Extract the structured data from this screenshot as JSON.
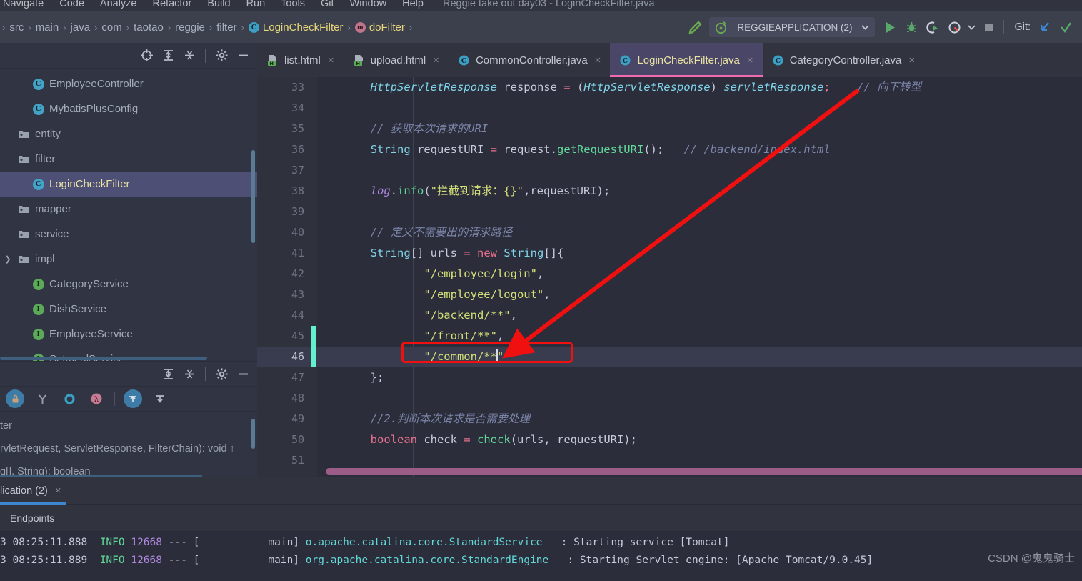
{
  "window": {
    "title": "Reggie take out day03 - LoginCheckFilter.java",
    "menu": [
      "Navigate",
      "Code",
      "Analyze",
      "Refactor",
      "Build",
      "Run",
      "Tools",
      "Git",
      "Window",
      "Help"
    ]
  },
  "breadcrumb": {
    "items": [
      "src",
      "main",
      "java",
      "com",
      "taotao",
      "reggie",
      "filter"
    ],
    "class_name": "LoginCheckFilter",
    "class_badge": "C",
    "method_name": "doFilter",
    "method_badge": "m",
    "separator": "›"
  },
  "toolbar": {
    "build_icon": "hammer-icon",
    "run_config": "REGGIEAPPLICATION (2)",
    "run_config_icon": "spring-boot-icon",
    "dropdown_icon": "chevron-down-icon",
    "run_icon": "run-icon",
    "debug_icon": "debug-icon",
    "run_coverage_icon": "run-with-coverage-icon",
    "profiler_icon": "profiler-icon",
    "profiler_dropdown_icon": "chevron-down-icon",
    "stop_icon": "stop-icon",
    "git_label": "Git:",
    "git_update_icon": "git-update-project-icon",
    "git_commit_icon": "git-commit-icon",
    "accent_run": "#59a869",
    "accent_active_tab": "#4a4668",
    "accent_tab_underline": "#f06ab0"
  },
  "sidebar": {
    "toolbar_icons": [
      "select-opened-file-icon",
      "expand-all-icon",
      "collapse-all-icon",
      "settings-gear-icon",
      "hide-panel-icon"
    ],
    "items": [
      {
        "label": "EmployeeController",
        "icon": "class-icon",
        "kind": "class",
        "indent": 1,
        "arrow": false,
        "selected": false
      },
      {
        "label": "MybatisPlusConfig",
        "icon": "class-icon",
        "kind": "class",
        "indent": 1,
        "arrow": false,
        "selected": false
      },
      {
        "label": "entity",
        "icon": "folder-icon",
        "kind": "folder",
        "indent": 0,
        "arrow": false,
        "selected": false
      },
      {
        "label": "filter",
        "icon": "folder-icon",
        "kind": "folder",
        "indent": 0,
        "arrow": false,
        "selected": false
      },
      {
        "label": "LoginCheckFilter",
        "icon": "class-icon",
        "kind": "class",
        "indent": 1,
        "arrow": false,
        "selected": true
      },
      {
        "label": "mapper",
        "icon": "folder-icon",
        "kind": "folder",
        "indent": 0,
        "arrow": false,
        "selected": false
      },
      {
        "label": "service",
        "icon": "folder-icon",
        "kind": "folder",
        "indent": 0,
        "arrow": false,
        "selected": false
      },
      {
        "label": "impl",
        "icon": "folder-icon",
        "kind": "folder",
        "indent": 0,
        "arrow": true,
        "selected": false
      },
      {
        "label": "CategoryService",
        "icon": "interface-icon",
        "kind": "interface",
        "indent": 1,
        "arrow": false,
        "selected": false
      },
      {
        "label": "DishService",
        "icon": "interface-icon",
        "kind": "interface",
        "indent": 1,
        "arrow": false,
        "selected": false
      },
      {
        "label": "EmployeeService",
        "icon": "interface-icon",
        "kind": "interface",
        "indent": 1,
        "arrow": false,
        "selected": false
      },
      {
        "label": "SetmealService",
        "icon": "interface-icon",
        "kind": "interface",
        "indent": 1,
        "arrow": false,
        "selected": false
      }
    ]
  },
  "structure": {
    "toolbar_icons": [
      "expand-all-icon",
      "collapse-all-icon",
      "settings-gear-icon",
      "hide-panel-icon"
    ],
    "filter_icons": [
      "show-non-public-icon",
      "show-inherited-icon",
      "show-fields-icon",
      "show-properties-icon",
      "sort-by-visibility-icon",
      "sort-alphabetically-icon"
    ],
    "rows": [
      {
        "text": "ter"
      },
      {
        "text": "rvletRequest, ServletResponse, FilterChain): void ↑"
      },
      {
        "text": "g[], String): boolean"
      }
    ]
  },
  "editor_tabs": [
    {
      "label": "list.html",
      "icon": "html-file-icon",
      "active": false,
      "close": "×"
    },
    {
      "label": "upload.html",
      "icon": "html-file-icon",
      "active": false,
      "close": "×"
    },
    {
      "label": "CommonController.java",
      "icon": "java-class-icon",
      "active": false,
      "close": "×"
    },
    {
      "label": "LoginCheckFilter.java",
      "icon": "java-class-icon",
      "active": true,
      "close": "×"
    },
    {
      "label": "CategoryController.java",
      "icon": "java-class-icon",
      "active": false,
      "close": "×"
    }
  ],
  "editor": {
    "first_line": 33,
    "current_line": 46,
    "changed_lines": [
      45,
      46
    ],
    "lines": [
      {
        "n": 33,
        "tokens": [
          {
            "t": "        ",
            "c": "pun"
          },
          {
            "t": "HttpServletResponse",
            "c": "typi"
          },
          {
            "t": " response ",
            "c": "var"
          },
          {
            "t": "=",
            "c": "op"
          },
          {
            "t": " (",
            "c": "pun"
          },
          {
            "t": "HttpServletResponse",
            "c": "typi"
          },
          {
            "t": ") ",
            "c": "pun"
          },
          {
            "t": "servletResponse",
            "c": "typi"
          },
          {
            "t": ";",
            "c": "op"
          },
          {
            "t": "    ",
            "c": "pun"
          },
          {
            "t": "// 向下转型",
            "c": "cmt"
          }
        ]
      },
      {
        "n": 34,
        "tokens": []
      },
      {
        "n": 35,
        "tokens": [
          {
            "t": "        ",
            "c": "pun"
          },
          {
            "t": "// 获取本次请求的URI",
            "c": "cmt"
          }
        ]
      },
      {
        "n": 36,
        "tokens": [
          {
            "t": "        ",
            "c": "pun"
          },
          {
            "t": "String",
            "c": "typ"
          },
          {
            "t": " requestURI ",
            "c": "var"
          },
          {
            "t": "=",
            "c": "op"
          },
          {
            "t": " request.",
            "c": "var"
          },
          {
            "t": "getRequestURI",
            "c": "mth"
          },
          {
            "t": "();",
            "c": "pun"
          },
          {
            "t": "   ",
            "c": "pun"
          },
          {
            "t": "// /backend/index.html",
            "c": "cmt"
          }
        ]
      },
      {
        "n": 37,
        "tokens": []
      },
      {
        "n": 38,
        "tokens": [
          {
            "t": "        ",
            "c": "pun"
          },
          {
            "t": "log",
            "c": "fld"
          },
          {
            "t": ".",
            "c": "pun"
          },
          {
            "t": "info",
            "c": "mth"
          },
          {
            "t": "(",
            "c": "pun"
          },
          {
            "t": "\"拦截到请求：{}\"",
            "c": "str"
          },
          {
            "t": ",requestURI);",
            "c": "pun"
          }
        ]
      },
      {
        "n": 39,
        "tokens": []
      },
      {
        "n": 40,
        "tokens": [
          {
            "t": "        ",
            "c": "pun"
          },
          {
            "t": "// 定义不需要出的请求路径",
            "c": "cmt"
          }
        ]
      },
      {
        "n": 41,
        "tokens": [
          {
            "t": "        ",
            "c": "pun"
          },
          {
            "t": "String",
            "c": "typ"
          },
          {
            "t": "[] urls ",
            "c": "var"
          },
          {
            "t": "=",
            "c": "op"
          },
          {
            "t": " ",
            "c": "pun"
          },
          {
            "t": "new",
            "c": "kw"
          },
          {
            "t": " ",
            "c": "pun"
          },
          {
            "t": "String",
            "c": "typ"
          },
          {
            "t": "[]{",
            "c": "pun"
          }
        ]
      },
      {
        "n": 42,
        "tokens": [
          {
            "t": "                ",
            "c": "pun"
          },
          {
            "t": "\"/employee/login\"",
            "c": "str"
          },
          {
            "t": ",",
            "c": "pun"
          }
        ]
      },
      {
        "n": 43,
        "tokens": [
          {
            "t": "                ",
            "c": "pun"
          },
          {
            "t": "\"/employee/logout\"",
            "c": "str"
          },
          {
            "t": ",",
            "c": "pun"
          }
        ]
      },
      {
        "n": 44,
        "tokens": [
          {
            "t": "                ",
            "c": "pun"
          },
          {
            "t": "\"/backend/**\"",
            "c": "str"
          },
          {
            "t": ",",
            "c": "pun"
          }
        ]
      },
      {
        "n": 45,
        "tokens": [
          {
            "t": "                ",
            "c": "pun"
          },
          {
            "t": "\"/front/**\"",
            "c": "str"
          },
          {
            "t": ",",
            "c": "pun"
          }
        ]
      },
      {
        "n": 46,
        "tokens": [
          {
            "t": "                ",
            "c": "pun"
          },
          {
            "t": "\"/common/**",
            "c": "str"
          },
          {
            "t": "|",
            "c": "caret"
          },
          {
            "t": "\"",
            "c": "str"
          }
        ]
      },
      {
        "n": 47,
        "tokens": [
          {
            "t": "        };",
            "c": "pun"
          }
        ]
      },
      {
        "n": 48,
        "tokens": []
      },
      {
        "n": 49,
        "tokens": [
          {
            "t": "        ",
            "c": "pun"
          },
          {
            "t": "//2.判断本次请求是否需要处理",
            "c": "cmt"
          }
        ]
      },
      {
        "n": 50,
        "tokens": [
          {
            "t": "        ",
            "c": "pun"
          },
          {
            "t": "boolean",
            "c": "kw"
          },
          {
            "t": " check ",
            "c": "var"
          },
          {
            "t": "=",
            "c": "op"
          },
          {
            "t": " ",
            "c": "pun"
          },
          {
            "t": "check",
            "c": "mth"
          },
          {
            "t": "(urls, requestURI);",
            "c": "pun"
          }
        ]
      },
      {
        "n": 51,
        "tokens": []
      },
      {
        "n": 52,
        "tokens": []
      }
    ],
    "annotation": {
      "type": "red-highlight-box",
      "target_text": "\"/common/**\"",
      "color": "#f01010",
      "arrow": "red-arrow-pointer"
    }
  },
  "console": {
    "tab_label": "lication (2)",
    "tab_close": "×",
    "sub_tab": "Endpoints",
    "active_underline_color": "#3d87d0",
    "lines": [
      {
        "ts": "3 08:25:11.888",
        "level": "INFO",
        "pid": "12668",
        "dashes": "---",
        "thread": "main]",
        "cls": "o.apache.catalina.core.StandardService",
        "msg": ": Starting service [Tomcat]"
      },
      {
        "ts": "3 08:25:11.889",
        "level": "INFO",
        "pid": "12668",
        "dashes": "---",
        "thread": "main]",
        "cls": "org.apache.catalina.core.StandardEngine",
        "msg": ": Starting Servlet engine: [Apache Tomcat/9.0.45]"
      }
    ]
  },
  "watermark": "CSDN @鬼鬼骑士"
}
